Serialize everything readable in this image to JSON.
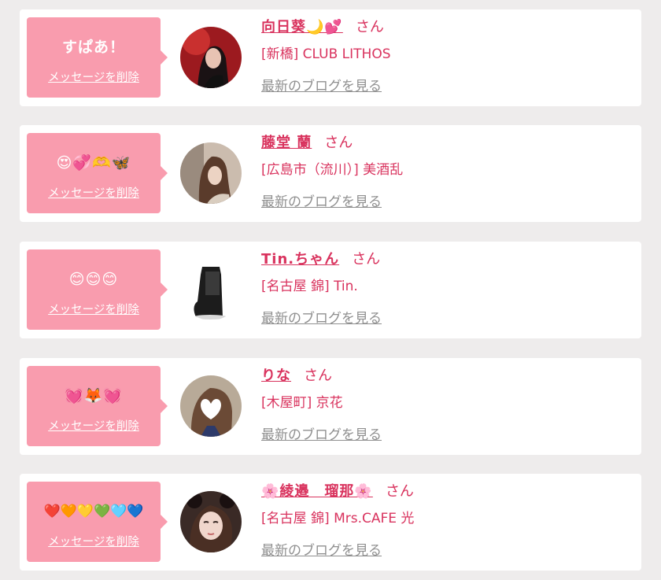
{
  "cards": [
    {
      "message": "すぱあ！",
      "delete_label": "メッセージを削除",
      "name": "向日葵🌙💕",
      "honorific": "さん",
      "shop": "[新橋] CLUB LITHOS",
      "blog_link": "最新のブログを見る"
    },
    {
      "message": "😍💞🫶🦋",
      "delete_label": "メッセージを削除",
      "name": "藤堂 蘭",
      "honorific": "さん",
      "shop": "[広島市（流川）] 美酒乱",
      "blog_link": "最新のブログを見る"
    },
    {
      "message": "😊😊😊",
      "delete_label": "メッセージを削除",
      "name": "Tin.ちゃん",
      "honorific": "さん",
      "shop": "[名古屋 錦] Tin.",
      "blog_link": "最新のブログを見る"
    },
    {
      "message": "💓🦊💓",
      "delete_label": "メッセージを削除",
      "name": "りな",
      "honorific": "さん",
      "shop": "[木屋町] 京花",
      "blog_link": "最新のブログを見る"
    },
    {
      "message": "❤️🧡💛💚🩵💙",
      "delete_label": "メッセージを削除",
      "name": "🌸綾邉　瑠那🌸",
      "honorific": "さん",
      "shop": "[名古屋 錦] Mrs.CAFE 光",
      "blog_link": "最新のブログを見る"
    }
  ],
  "colors": {
    "bubble": "#f99cae",
    "name": "#d9335e",
    "link": "#8f8f8f",
    "background": "#eeecec"
  }
}
